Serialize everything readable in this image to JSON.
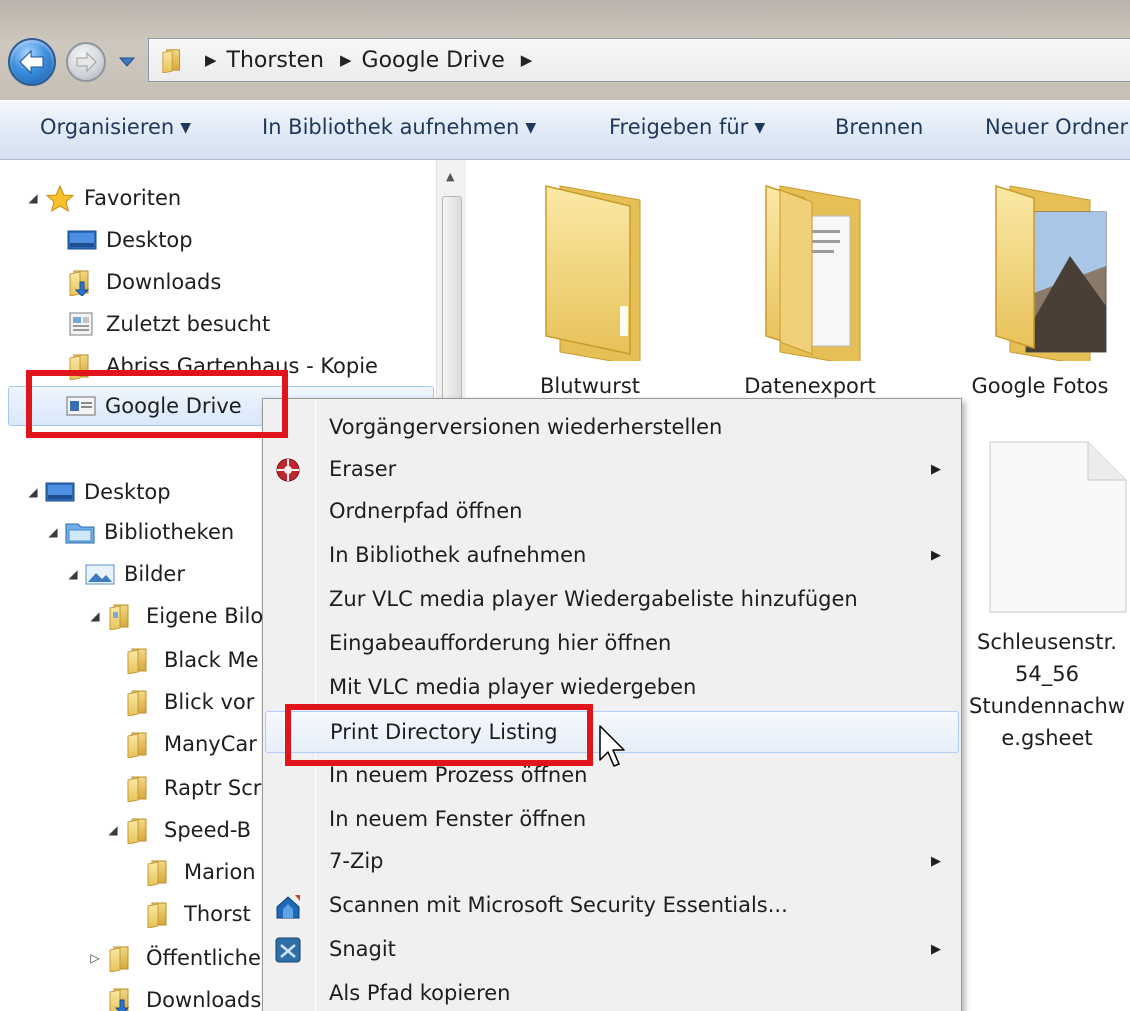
{
  "address_bar": {
    "breadcrumbs": [
      "Thorsten",
      "Google Drive"
    ],
    "back_icon": "back-arrow-icon",
    "forward_icon": "forward-arrow-icon"
  },
  "command_bar": {
    "items": [
      {
        "label": "Organisieren",
        "dropdown": true
      },
      {
        "label": "In Bibliothek aufnehmen",
        "dropdown": true
      },
      {
        "label": "Freigeben für",
        "dropdown": true
      },
      {
        "label": "Brennen",
        "dropdown": false
      },
      {
        "label": "Neuer Ordner",
        "dropdown": false
      }
    ]
  },
  "navigation_pane": {
    "favorites": {
      "header": "Favoriten",
      "items": [
        "Desktop",
        "Downloads",
        "Zuletzt besucht",
        "Abriss Gartenhaus - Kopie",
        "Google Drive"
      ]
    },
    "tree": {
      "desktop": "Desktop",
      "bibliotheken": "Bibliotheken",
      "bilder": "Bilder",
      "eigene_bilder": "Eigene Bilo",
      "folders": [
        "Black Me",
        "Blick vor",
        "ManyCar",
        "Raptr Scr"
      ],
      "speed": "Speed-B",
      "speed_children": [
        "Marion",
        "Thorst"
      ],
      "oeffentliche": "Öffentliche",
      "downloads": "Downloads"
    }
  },
  "content": {
    "tiles": [
      {
        "label": "Blutwurst"
      },
      {
        "label": "Datenexport"
      },
      {
        "label": "Google Fotos"
      },
      {
        "label_lines": [
          "Schleusenstr.",
          "54_56",
          "Stundennachw",
          "e.gsheet"
        ]
      }
    ]
  },
  "context_menu": {
    "items": [
      {
        "label": "Vorgängerversionen wiederherstellen",
        "submenu": false,
        "icon": ""
      },
      {
        "label": "Eraser",
        "submenu": true,
        "icon": "eraser-icon"
      },
      {
        "label": "Ordnerpfad öffnen",
        "submenu": false,
        "icon": ""
      },
      {
        "label": "In Bibliothek aufnehmen",
        "submenu": true,
        "icon": ""
      },
      {
        "label": "Zur VLC media player Wiedergabeliste hinzufügen",
        "submenu": false,
        "icon": ""
      },
      {
        "label": "Eingabeaufforderung hier öffnen",
        "submenu": false,
        "icon": ""
      },
      {
        "label": "Mit VLC media player wiedergeben",
        "submenu": false,
        "icon": ""
      },
      {
        "label": "Print Directory Listing",
        "submenu": false,
        "icon": "",
        "hovered": true
      },
      {
        "label": "In neuem Prozess öffnen",
        "submenu": false,
        "icon": ""
      },
      {
        "label": "In neuem Fenster öffnen",
        "submenu": false,
        "icon": ""
      },
      {
        "label": "7-Zip",
        "submenu": true,
        "icon": ""
      },
      {
        "label": "Scannen mit Microsoft Security Essentials...",
        "submenu": false,
        "icon": "security-essentials-icon"
      },
      {
        "label": "Snagit",
        "submenu": true,
        "icon": "snagit-icon"
      },
      {
        "label": "Als Pfad kopieren",
        "submenu": false,
        "icon": ""
      }
    ]
  },
  "colors": {
    "highlight": "#e0141b",
    "command_bar_text": "#1e395b",
    "selection": "#d9e8fb"
  }
}
